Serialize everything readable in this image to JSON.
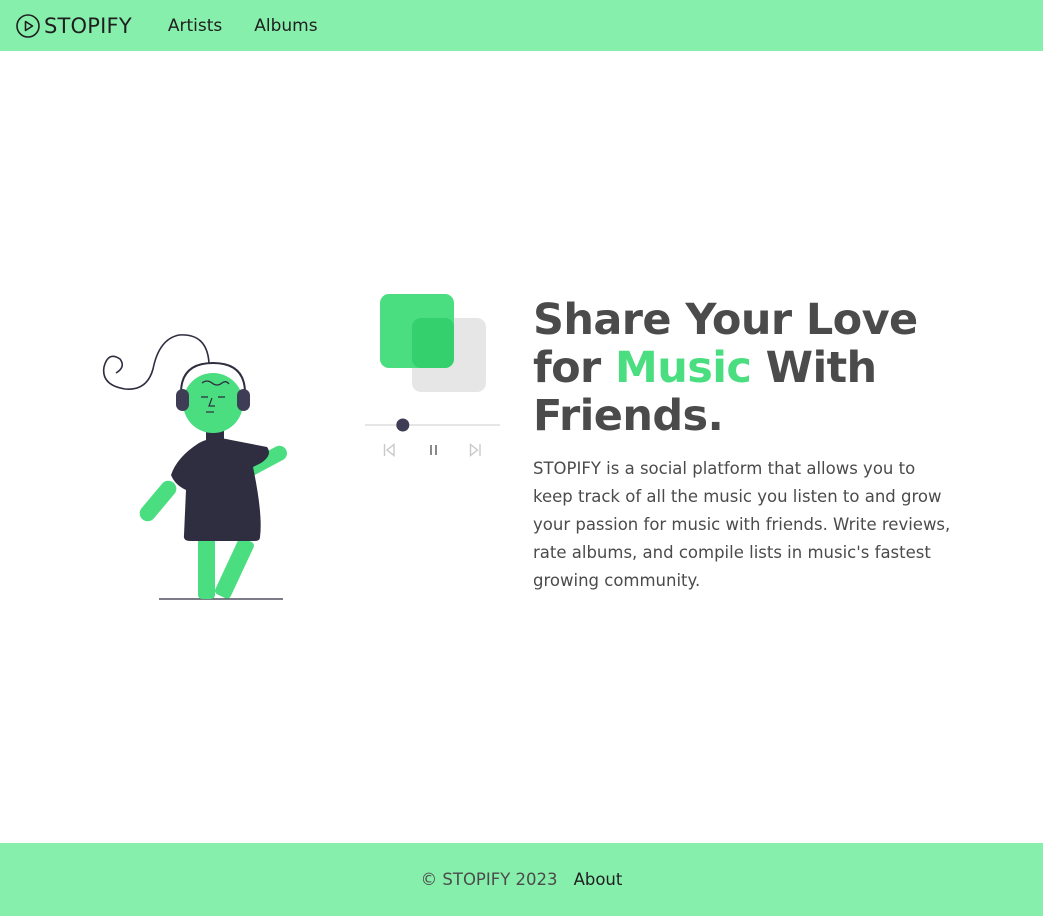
{
  "navbar": {
    "brand": "STOPIFY",
    "brand_icon": "play-circle-icon",
    "links": [
      "Artists",
      "Albums"
    ]
  },
  "hero": {
    "headline_line1": "Share Your Love",
    "headline_line2_start": "for ",
    "headline_accent": "Music",
    "headline_line2_end": " With",
    "headline_line3": "Friends.",
    "description": "STOPIFY is a social platform that allows you to keep track of all the music you listen to and grow your passion for music with friends. Write reviews, rate albums, and compile lists in music's fastest growing community."
  },
  "player": {
    "controls": [
      "previous-icon",
      "pause-icon",
      "next-icon"
    ],
    "progress": 0.28
  },
  "footer": {
    "copyright": "© STOPIFY 2023",
    "about": "About"
  },
  "colors": {
    "nav_background": "#86efac",
    "accent": "#4ade80",
    "text": "#4b4b4b",
    "figure_dark": "#2f2e41",
    "card_gray": "#e6e6e6"
  }
}
